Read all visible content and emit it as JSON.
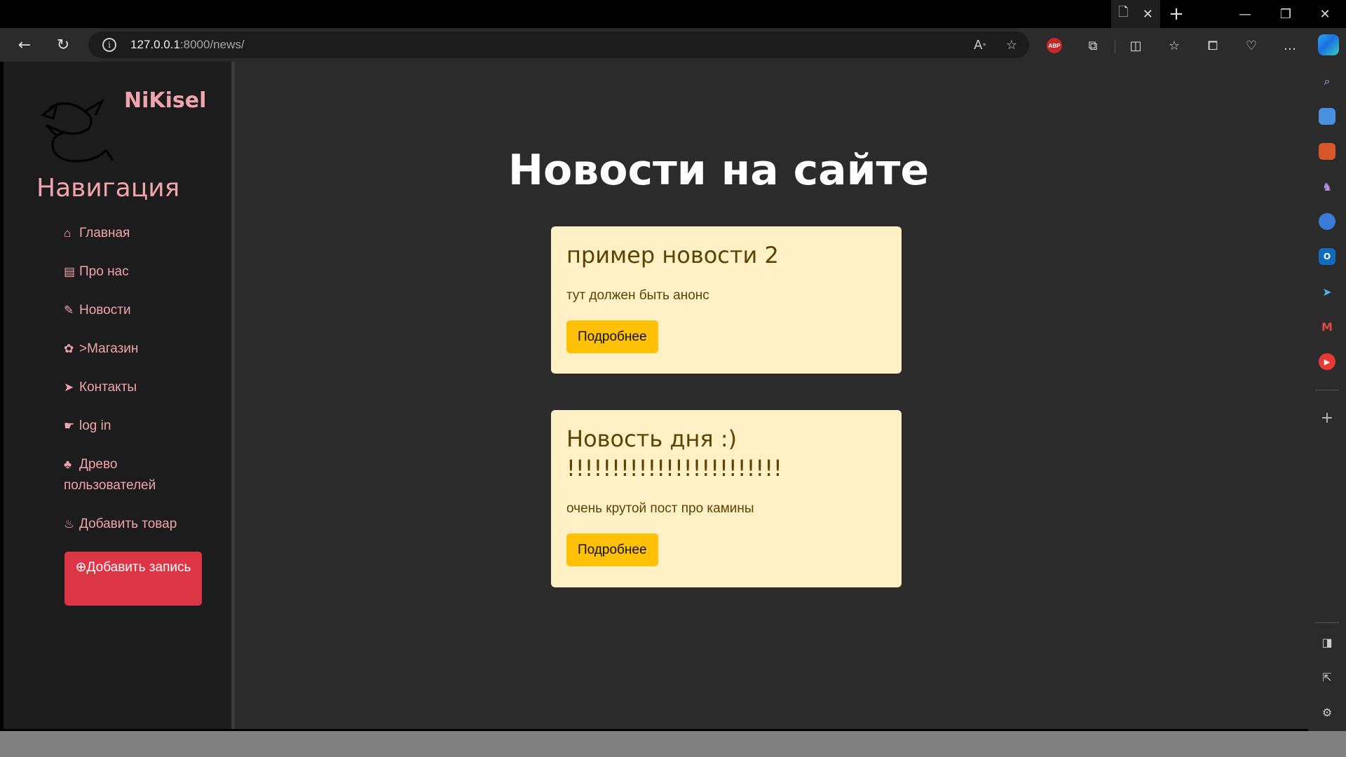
{
  "browser": {
    "url_host": "127.0.0.1",
    "url_rest": ":8000/news/",
    "abp_label": "ABP"
  },
  "sidebar": {
    "brand": "NiKisel",
    "nav_title": "Навигация",
    "items": [
      {
        "icon": "⌂",
        "label": "Главная"
      },
      {
        "icon": "▤",
        "label": "Про нас"
      },
      {
        "icon": "✎",
        "label": "Новости"
      },
      {
        "icon": "✿",
        "label": ">Магазин"
      },
      {
        "icon": "➤",
        "label": "Контакты"
      },
      {
        "icon": "☛",
        "label": "log in"
      },
      {
        "icon": "♣",
        "label": "Древо пользователей"
      },
      {
        "icon": "♨",
        "label": "Добавить товар"
      }
    ],
    "add_button_icon": "⊕",
    "add_button_label": "Добавить запись"
  },
  "main": {
    "title": "Новости на сайте",
    "news": [
      {
        "title": "пример новости 2",
        "summary": "тут должен быть анонс",
        "button": "Подробнее"
      },
      {
        "title": "Новость дня :) !!!!!!!!!!!!!!!!!!!!!!!!",
        "summary": "очень крутой пост про камины",
        "button": "Подробнее"
      }
    ]
  },
  "colors": {
    "accent_pink": "#f0a4ad",
    "card_bg": "#fff0c6",
    "button_yellow": "#ffc107",
    "add_button_red": "#dc3545"
  }
}
